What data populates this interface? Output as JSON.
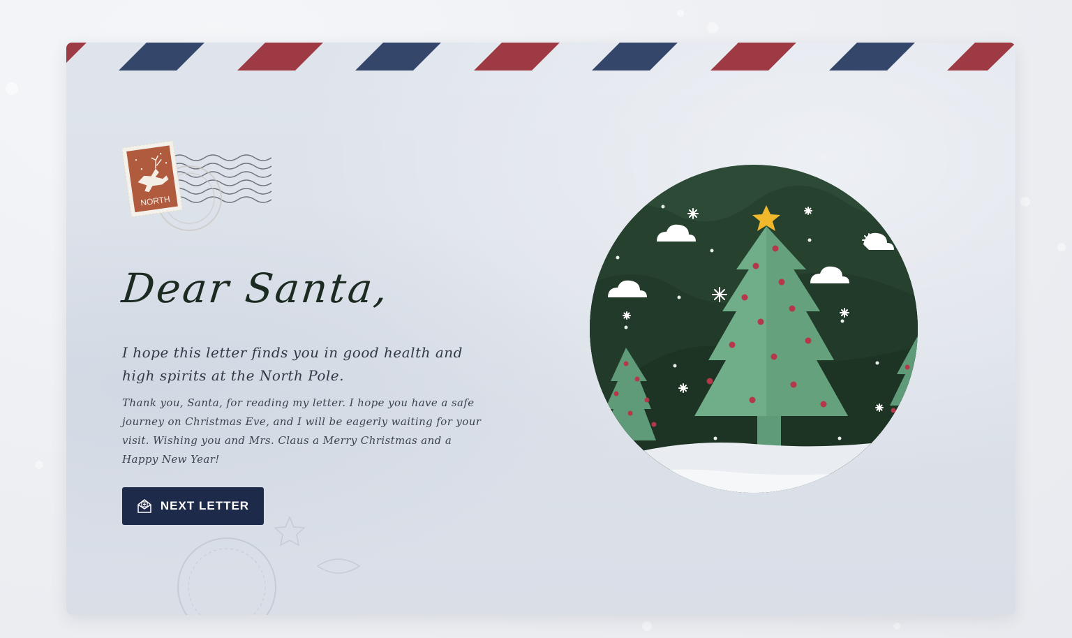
{
  "letter": {
    "greeting": "Dear Santa,",
    "lead": "I hope this letter finds you in good health and high spirits at the North Pole.",
    "body": "Thank you, Santa, for reading my letter. I hope you have a safe journey on Christmas Eve, and I will be eagerly waiting for your visit. Wishing you and Mrs. Claus a Merry Christmas and a Happy New Year!"
  },
  "stamp": {
    "label": "NORTH",
    "icon": "reindeer-icon"
  },
  "postmark": {
    "icon": "postmark-icon"
  },
  "button": {
    "label": "NEXT LETTER",
    "icon": "envelope-open-icon"
  },
  "illustration": {
    "icon": "christmas-tree-scene-icon"
  },
  "colors": {
    "airmail_blue": "#34466a",
    "airmail_red": "#9e3a44",
    "button_bg": "#1e2a4a",
    "stamp_red": "#b05a3e",
    "tree_green": "#6fae88",
    "scene_bg": "#2c4a36"
  }
}
